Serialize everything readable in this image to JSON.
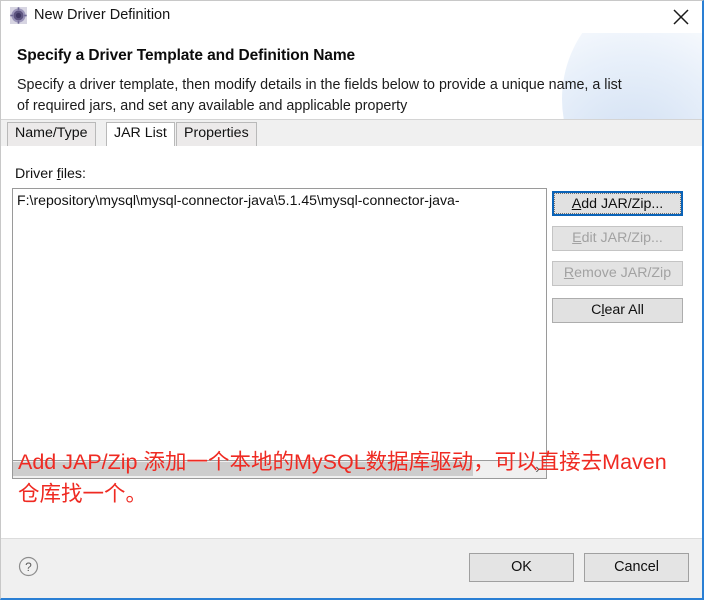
{
  "window": {
    "title": "New Driver Definition",
    "icon": "driver-definition-icon",
    "close_label": "close-icon"
  },
  "header": {
    "title": "Specify a Driver Template and Definition Name",
    "description": "Specify a driver template, then modify details in the fields below to provide a unique name, a list of required jars, and set any available and applicable property"
  },
  "tabs": [
    {
      "label": "Name/Type",
      "active": false
    },
    {
      "label": "JAR List",
      "active": true
    },
    {
      "label": "Properties",
      "active": false
    }
  ],
  "jar_list_tab": {
    "field_label_prefix": "Driver ",
    "field_label_mnemonic": "f",
    "field_label_suffix": "iles:",
    "files": [
      "F:\\repository\\mysql\\mysql-connector-java\\5.1.45\\mysql-connector-java-"
    ],
    "scrollbar": {
      "arrow_glyph": "›",
      "thumb_position_pct": 0,
      "thumb_width_pct": 86
    },
    "buttons": [
      {
        "label_before": "",
        "mnemonic": "A",
        "label_after": "dd JAR/Zip...",
        "state": "focused"
      },
      {
        "label_before": "",
        "mnemonic": "E",
        "label_after": "dit JAR/Zip...",
        "state": "disabled"
      },
      {
        "label_before": "",
        "mnemonic": "R",
        "label_after": "emove JAR/Zip",
        "state": "disabled"
      },
      {
        "label_before": "C",
        "mnemonic": "l",
        "label_after": "ear All",
        "state": "enabled"
      }
    ]
  },
  "annotation": {
    "text": "Add JAP/Zip 添加一个本地的MySQL数据库驱动，可以直接去Maven仓库找一个。",
    "color": "#ef2a22"
  },
  "footer": {
    "help_glyph": "?",
    "ok_label": "OK",
    "cancel_label": "Cancel"
  }
}
